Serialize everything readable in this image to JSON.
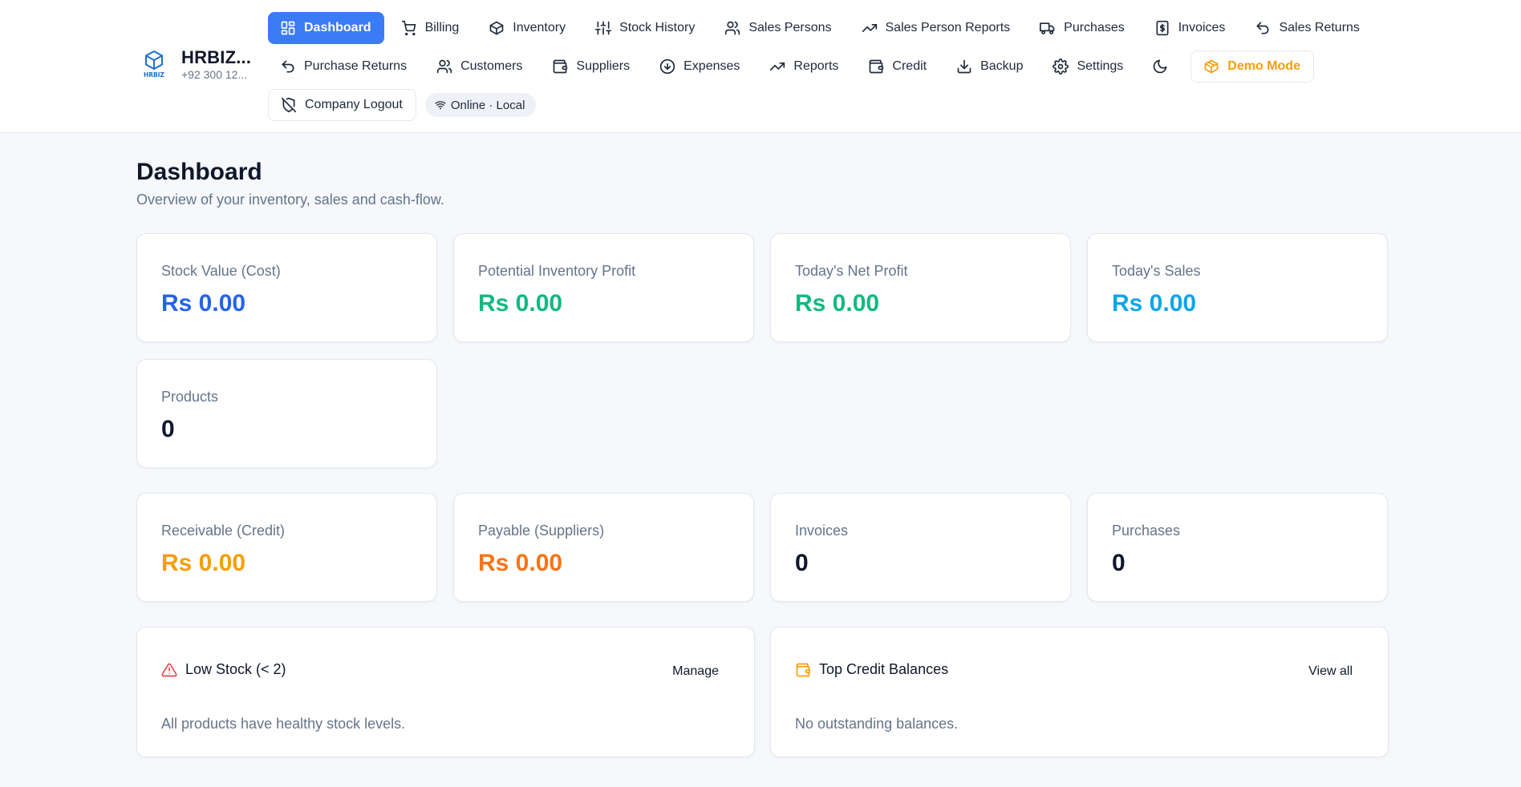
{
  "brand": {
    "name": "HRBIZ...",
    "phone": "+92 300 12...",
    "logo_text": "HRBIZ"
  },
  "nav": {
    "row1": [
      {
        "label": "Dashboard",
        "icon": "dashboard-icon",
        "active": true
      },
      {
        "label": "Billing",
        "icon": "cart-icon"
      },
      {
        "label": "Inventory",
        "icon": "box-icon"
      },
      {
        "label": "Stock History",
        "icon": "sliders-icon"
      },
      {
        "label": "Sales Persons",
        "icon": "users-icon"
      },
      {
        "label": "Sales Person Reports",
        "icon": "trending-up-icon"
      },
      {
        "label": "Purchases",
        "icon": "truck-icon"
      },
      {
        "label": "Invoices",
        "icon": "dollar-file-icon"
      },
      {
        "label": "Sales Returns",
        "icon": "undo-icon"
      }
    ],
    "row2": [
      {
        "label": "Purchase Returns",
        "icon": "undo-icon"
      },
      {
        "label": "Customers",
        "icon": "users-icon"
      },
      {
        "label": "Suppliers",
        "icon": "wallet-icon"
      },
      {
        "label": "Expenses",
        "icon": "arrow-down-circle-icon"
      },
      {
        "label": "Reports",
        "icon": "trending-up-icon"
      },
      {
        "label": "Credit",
        "icon": "wallet-icon"
      },
      {
        "label": "Backup",
        "icon": "download-icon"
      },
      {
        "label": "Settings",
        "icon": "gear-icon"
      }
    ],
    "theme_toggle_icon": "moon-icon",
    "demo_mode": "Demo Mode",
    "company_logout": "Company Logout",
    "status": "Online · Local"
  },
  "page": {
    "title": "Dashboard",
    "subtitle": "Overview of your inventory, sales and cash-flow."
  },
  "stats": [
    {
      "label": "Stock Value (Cost)",
      "value": "Rs 0.00",
      "color": "#2563eb"
    },
    {
      "label": "Potential Inventory Profit",
      "value": "Rs 0.00",
      "color": "#10b981"
    },
    {
      "label": "Today's Net Profit",
      "value": "Rs 0.00",
      "color": "#10b981"
    },
    {
      "label": "Today's Sales",
      "value": "Rs 0.00",
      "color": "#0ea5e9"
    },
    {
      "label": "Products",
      "value": "0",
      "color": "#0f172a"
    },
    {
      "label": "Receivable (Credit)",
      "value": "Rs 0.00",
      "color": "#f59e0b"
    },
    {
      "label": "Payable (Suppliers)",
      "value": "Rs 0.00",
      "color": "#f97316"
    },
    {
      "label": "Invoices",
      "value": "0",
      "color": "#0f172a"
    },
    {
      "label": "Purchases",
      "value": "0",
      "color": "#0f172a"
    }
  ],
  "panels": {
    "low_stock": {
      "title": "Low Stock (< 2)",
      "action": "Manage",
      "empty": "All products have healthy stock levels.",
      "icon_color": "#ef4444"
    },
    "top_credit": {
      "title": "Top Credit Balances",
      "action": "View all",
      "empty": "No outstanding balances.",
      "icon_color": "#f59e0b"
    }
  }
}
